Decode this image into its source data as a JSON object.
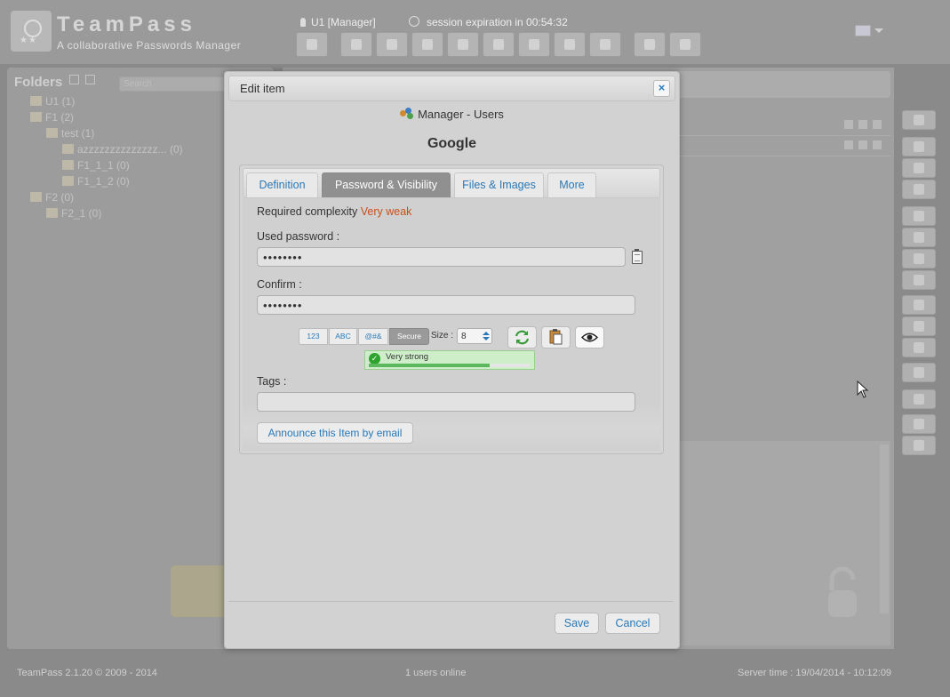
{
  "app": {
    "title": "TeamPass",
    "subtitle": "A collaborative Passwords Manager",
    "user": "U1 [Manager]",
    "session": "session expiration in  00:54:32",
    "toolbar_icons": [
      "home-icon",
      "key-icon",
      "binoculars-icon",
      "import-icon",
      "star-icon",
      "folders-icon",
      "roles-icon",
      "users-icon",
      "views-icon",
      "refresh-icon",
      "book-icon"
    ],
    "language_flag": "us-flag-icon"
  },
  "folders": {
    "title": "Folders",
    "search_placeholder": "Search",
    "tree": [
      {
        "label": "U1 (1)"
      },
      {
        "label": "F1 (2)"
      },
      {
        "label": "test (1)"
      },
      {
        "label": "azzzzzzzzzzzzzz... (0)"
      },
      {
        "label": "F1_1_1 (0)"
      },
      {
        "label": "F1_1_2 (0)"
      },
      {
        "label": "F2 (0)"
      },
      {
        "label": "F2_1 (0)"
      }
    ]
  },
  "modal": {
    "title": "Edit item",
    "close_symbol": "×",
    "folder_path": "Manager - Users",
    "item_name": "Google",
    "tabs": [
      {
        "label": "Definition"
      },
      {
        "label": "Password & Visibility"
      },
      {
        "label": "Files & Images"
      },
      {
        "label": "More"
      }
    ],
    "active_tab": "Password & Visibility",
    "complexity_label": "Required complexity",
    "complexity_value": "Very weak",
    "password_label": "Used password :",
    "password_value": "••••••••",
    "confirm_label": "Confirm :",
    "confirm_value": "••••••••",
    "generator": {
      "options": [
        {
          "label": "123"
        },
        {
          "label": "ABC"
        },
        {
          "label": "@#&"
        },
        {
          "label": "Secure"
        }
      ],
      "selected_option": "Secure",
      "size_label": "Size :",
      "size_value": "8"
    },
    "strength": {
      "text": "Very strong",
      "level": 0.75
    },
    "tags_label": "Tags :",
    "tags_value": "",
    "announce_label": "Announce this Item by email",
    "save_label": "Save",
    "cancel_label": "Cancel"
  },
  "footer": {
    "version": "TeamPass 2.1.20 © 2009 - 2014",
    "online": "1 users online",
    "server_time": "Server time : 19/04/2014 - 10:12:09"
  },
  "colors": {
    "accent": "#2a78b5",
    "weak": "#c8501a",
    "strength_fill": "#5cb85c"
  }
}
